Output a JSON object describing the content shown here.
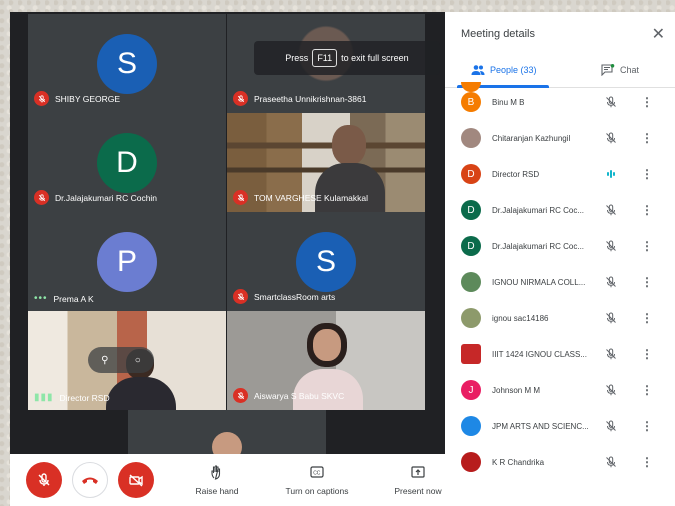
{
  "meeting": {
    "tiles": [
      {
        "id": "shiby",
        "initial": "S",
        "color": "#1a5fb4",
        "name": "SHIBY GEORGE",
        "muted": true
      },
      {
        "id": "praseetha",
        "initial": "",
        "color": "",
        "name": "Praseetha Unnikrishnan-3861",
        "muted": true
      },
      {
        "id": "jalaja",
        "initial": "D",
        "color": "#0b6b4b",
        "name": "Dr.Jalajakumari RC Cochin",
        "muted": true
      },
      {
        "id": "tom",
        "initial": "",
        "color": "",
        "name": "TOM VARGHESE Kulamakkal",
        "muted": true
      },
      {
        "id": "prema",
        "initial": "P",
        "color": "#6b7dd1",
        "name": "Prema A K",
        "muted": false
      },
      {
        "id": "smartclass",
        "initial": "S",
        "color": "#1a5fb4",
        "name": "SmartclassRoom arts",
        "muted": true
      },
      {
        "id": "director",
        "initial": "",
        "color": "",
        "name": "Director RSD",
        "muted": false
      },
      {
        "id": "aiswarya",
        "initial": "",
        "color": "",
        "name": "Aiswarya S Babu SKVC",
        "muted": true
      }
    ],
    "fullscreen_hint": {
      "press": "Press",
      "key": "F11",
      "rest": "to exit full screen"
    }
  },
  "toolbar": {
    "raise_hand": "Raise hand",
    "captions": "Turn on captions",
    "present": "Present now"
  },
  "panel": {
    "title": "Meeting details",
    "tab_people": "People (33)",
    "tab_chat": "Chat",
    "participants": [
      {
        "initial": "B",
        "color": "#f57c00",
        "name": "Binu M B",
        "status": "muted"
      },
      {
        "initial": "",
        "color": "#a1887f",
        "name": "Chitaranjan Kazhungil",
        "status": "muted"
      },
      {
        "initial": "D",
        "color": "#d84315",
        "name": "Director RSD",
        "status": "speaking"
      },
      {
        "initial": "D",
        "color": "#0b6b4b",
        "name": "Dr.Jalajakumari RC Coc...",
        "status": "muted"
      },
      {
        "initial": "D",
        "color": "#0b6b4b",
        "name": "Dr.Jalajakumari RC Coc...",
        "status": "muted"
      },
      {
        "initial": "",
        "color": "#5d8a5b",
        "name": "IGNOU NIRMALA COLL...",
        "status": "muted"
      },
      {
        "initial": "",
        "color": "#8d9a6b",
        "name": "ignou sac14186",
        "status": "muted"
      },
      {
        "initial": "",
        "color": "#c62828",
        "name": "IIIT 1424 IGNOU CLASS...",
        "status": "muted"
      },
      {
        "initial": "J",
        "color": "#e91e63",
        "name": "Johnson M M",
        "status": "muted"
      },
      {
        "initial": "",
        "color": "#1e88e5",
        "name": "JPM ARTS AND SCIENC...",
        "status": "muted"
      },
      {
        "initial": "",
        "color": "#b71c1c",
        "name": "K R Chandrika",
        "status": "muted"
      }
    ]
  }
}
